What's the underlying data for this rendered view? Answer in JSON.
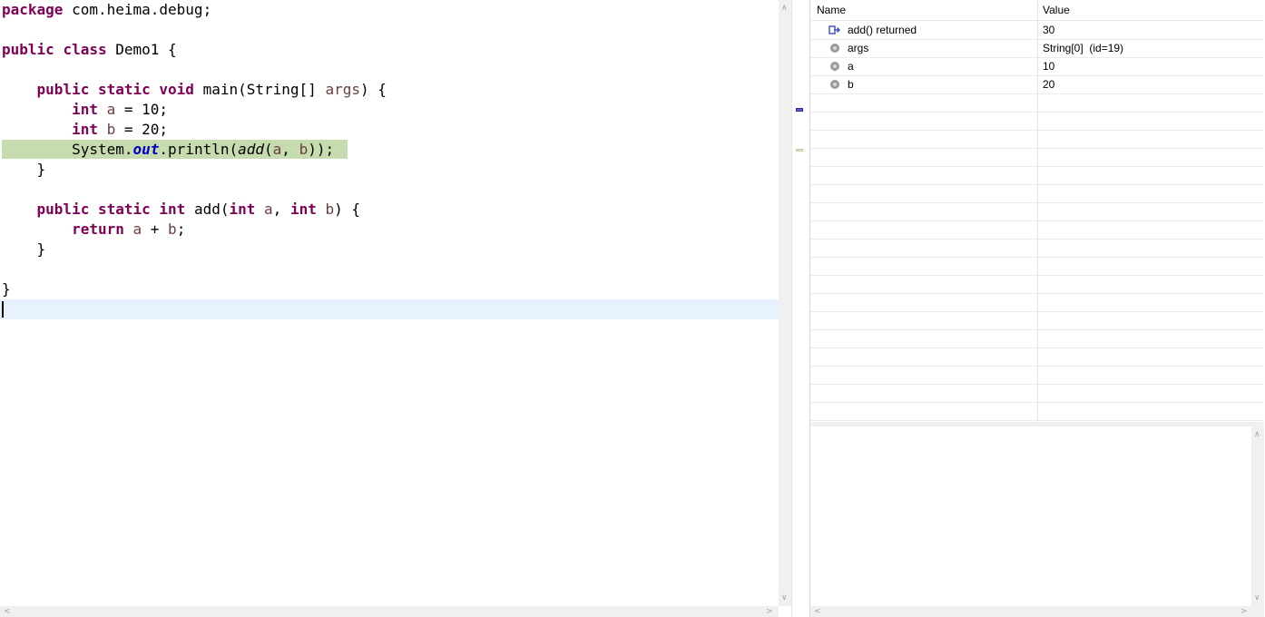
{
  "editor": {
    "lines": {
      "l1": {
        "kw": "package",
        "rest": " com.heima.debug;"
      },
      "l3": {
        "kw1": "public",
        "kw2": "class",
        "rest": " Demo1 {"
      },
      "l5": {
        "indent": "    ",
        "kw1": "public",
        "kw2": "static",
        "kw3": "void",
        "mid": " main(String[] ",
        "var": "args",
        "end": ") {"
      },
      "l6": {
        "indent": "        ",
        "kw": "int",
        "sp": " ",
        "var": "a",
        "rest": " = 10;"
      },
      "l7": {
        "indent": "        ",
        "kw": "int",
        "sp": " ",
        "var": "b",
        "rest": " = 20;"
      },
      "l8": {
        "indent": "        ",
        "cls": "System.",
        "field": "out",
        "mid": ".println(",
        "call": "add",
        "open": "(",
        "va": "a",
        "comma": ", ",
        "vb": "b",
        "end": "));"
      },
      "l9": {
        "text": "    }"
      },
      "l11": {
        "indent": "    ",
        "kw1": "public",
        "kw2": "static",
        "kw3": "int",
        "mid": " add(",
        "kw4": "int",
        "sp1": " ",
        "va": "a",
        "comma": ", ",
        "kw5": "int",
        "sp2": " ",
        "vb": "b",
        "end": ") {"
      },
      "l12": {
        "indent": "        ",
        "kw": "return",
        "sp": " ",
        "va": "a",
        "op": " + ",
        "vb": "b",
        "end": ";"
      },
      "l13": {
        "text": "    }"
      },
      "l15": {
        "text": "}"
      }
    }
  },
  "variables": {
    "header": {
      "name": "Name",
      "value": "Value"
    },
    "rows": [
      {
        "name": "add() returned",
        "value": "30",
        "icon": "return-value-icon"
      },
      {
        "name": "args",
        "value": "String[0]  (id=19)",
        "icon": "local-variable-icon"
      },
      {
        "name": "a",
        "value": "10",
        "icon": "local-variable-icon"
      },
      {
        "name": "b",
        "value": "20",
        "icon": "local-variable-icon"
      }
    ]
  },
  "colors": {
    "keyword": "#7f0055",
    "local_variable": "#6a3e3e",
    "static_field": "#0000c0",
    "debug_line_highlight": "#c6dbae",
    "current_line": "#e8f2fe"
  }
}
